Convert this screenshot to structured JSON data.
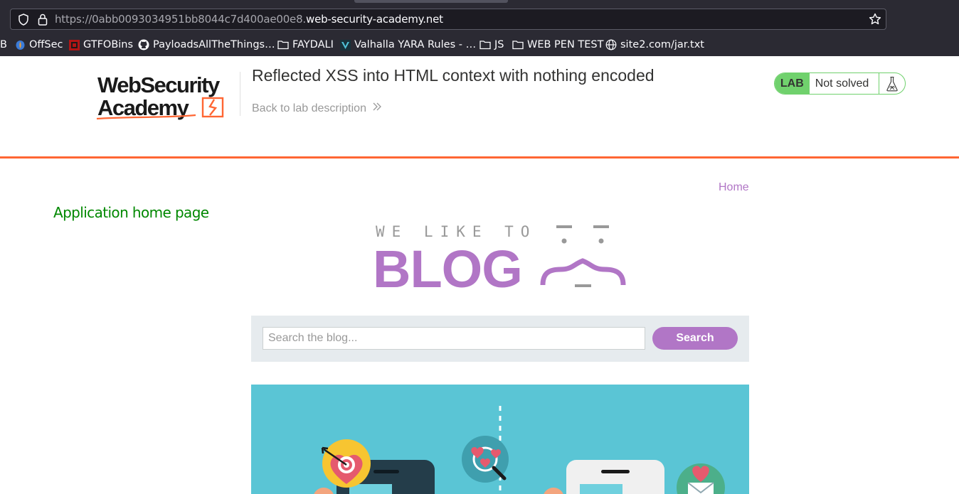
{
  "browser": {
    "url_prefix": "https://0abb0093034951bb8044c7d400ae00e8.",
    "url_domain": "web-security-academy.net",
    "bookmarks": [
      {
        "label": "B"
      },
      {
        "label": "OffSec"
      },
      {
        "label": "GTFOBins"
      },
      {
        "label": "PayloadsAllTheThings…"
      },
      {
        "label": "FAYDALI"
      },
      {
        "label": "Valhalla YARA Rules - …"
      },
      {
        "label": "JS"
      },
      {
        "label": "WEB PEN TEST"
      },
      {
        "label": "site2.com/jar.txt"
      }
    ]
  },
  "lab": {
    "title": "Reflected XSS into HTML context with nothing encoded",
    "back_link": "Back to lab description",
    "badge": "LAB",
    "status": "Not solved",
    "logo_line1": "WebSecurity",
    "logo_line2": "Academy"
  },
  "app": {
    "home_link": "Home",
    "home_page_text": "Application home page",
    "blog_tagline": "WE LIKE TO",
    "blog_word": "BLOG",
    "search_placeholder": "Search the blog...",
    "search_button": "Search"
  },
  "colors": {
    "accent_orange": "#ff6633",
    "lab_green": "#70d16d",
    "blog_purple": "#b176c6",
    "app_green": "#008800",
    "post_bg": "#5ac5d5"
  }
}
